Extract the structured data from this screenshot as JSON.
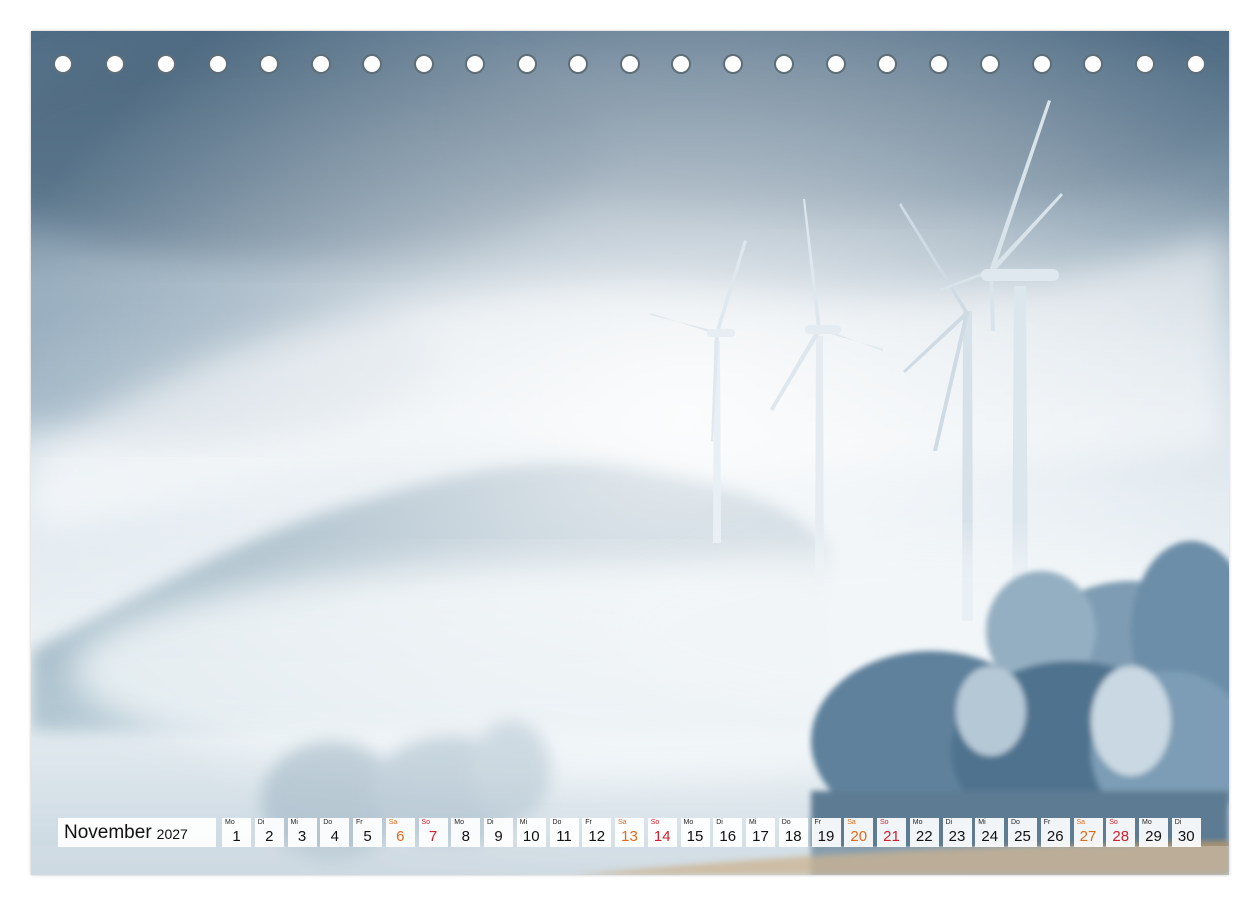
{
  "calendar": {
    "month": "November",
    "year": "2027",
    "days": [
      {
        "dow": "Mo",
        "num": "1",
        "kind": "weekday"
      },
      {
        "dow": "Di",
        "num": "2",
        "kind": "weekday"
      },
      {
        "dow": "Mi",
        "num": "3",
        "kind": "weekday"
      },
      {
        "dow": "Do",
        "num": "4",
        "kind": "weekday"
      },
      {
        "dow": "Fr",
        "num": "5",
        "kind": "weekday"
      },
      {
        "dow": "Sa",
        "num": "6",
        "kind": "sat"
      },
      {
        "dow": "So",
        "num": "7",
        "kind": "sun"
      },
      {
        "dow": "Mo",
        "num": "8",
        "kind": "weekday"
      },
      {
        "dow": "Di",
        "num": "9",
        "kind": "weekday"
      },
      {
        "dow": "Mi",
        "num": "10",
        "kind": "weekday"
      },
      {
        "dow": "Do",
        "num": "11",
        "kind": "weekday"
      },
      {
        "dow": "Fr",
        "num": "12",
        "kind": "weekday"
      },
      {
        "dow": "Sa",
        "num": "13",
        "kind": "sat"
      },
      {
        "dow": "So",
        "num": "14",
        "kind": "sun"
      },
      {
        "dow": "Mo",
        "num": "15",
        "kind": "weekday"
      },
      {
        "dow": "Di",
        "num": "16",
        "kind": "weekday"
      },
      {
        "dow": "Mi",
        "num": "17",
        "kind": "weekday"
      },
      {
        "dow": "Do",
        "num": "18",
        "kind": "weekday"
      },
      {
        "dow": "Fr",
        "num": "19",
        "kind": "weekday"
      },
      {
        "dow": "Sa",
        "num": "20",
        "kind": "sat"
      },
      {
        "dow": "So",
        "num": "21",
        "kind": "sun"
      },
      {
        "dow": "Mo",
        "num": "22",
        "kind": "weekday"
      },
      {
        "dow": "Di",
        "num": "23",
        "kind": "weekday"
      },
      {
        "dow": "Mi",
        "num": "24",
        "kind": "weekday"
      },
      {
        "dow": "Do",
        "num": "25",
        "kind": "weekday"
      },
      {
        "dow": "Fr",
        "num": "26",
        "kind": "weekday"
      },
      {
        "dow": "Sa",
        "num": "27",
        "kind": "sat"
      },
      {
        "dow": "So",
        "num": "28",
        "kind": "sun"
      },
      {
        "dow": "Mo",
        "num": "29",
        "kind": "weekday"
      },
      {
        "dow": "Di",
        "num": "30",
        "kind": "weekday"
      }
    ]
  },
  "binding_holes_count": 23,
  "colors": {
    "saturday": "#e06a1a",
    "sunday": "#d0202a",
    "sky_dark": "#4f6c84",
    "fog": "#e6eef3"
  },
  "photo": {
    "subject": "wind-turbines-in-fog",
    "turbine_count": 4
  }
}
